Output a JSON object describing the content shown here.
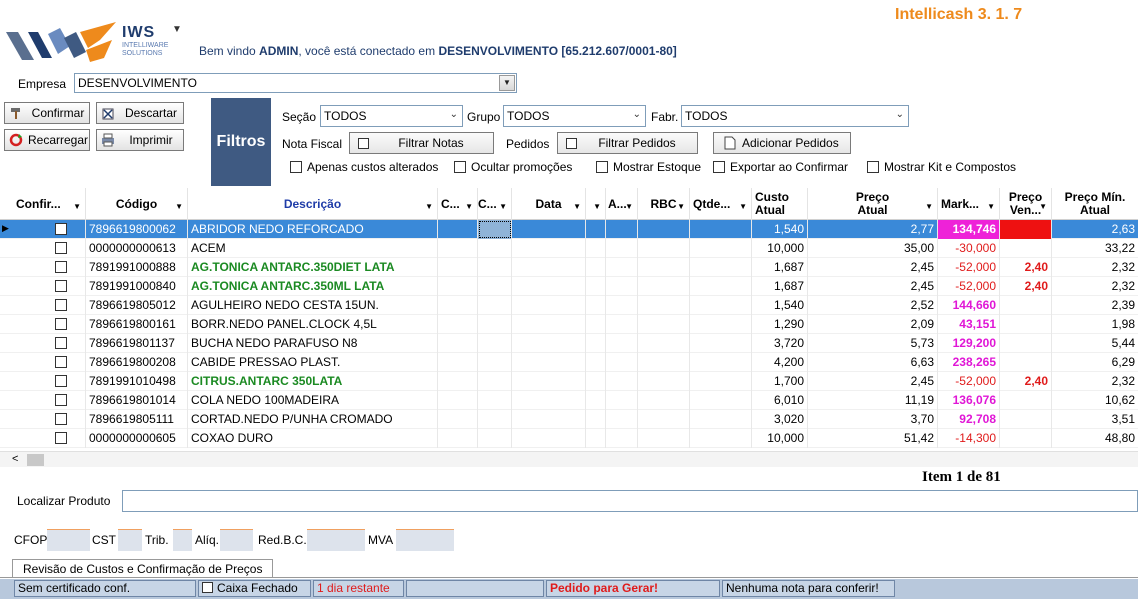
{
  "header": {
    "app_title": "Intellicash 3. 1.  7",
    "logo_name": "IWS",
    "logo_sub1": "INTELLIWARE",
    "logo_sub2": "SOLUTIONS",
    "welcome_pre": "Bem vindo ",
    "user": "ADMIN",
    "welcome_mid": ", você está conectado em ",
    "company": "DESENVOLVIMENTO [65.212.607/0001-80]"
  },
  "empresa": {
    "label": "Empresa",
    "value": "DESENVOLVIMENTO"
  },
  "actions": {
    "confirmar": "Confirmar",
    "descartar": "Descartar",
    "recarregar": "Recarregar",
    "imprimir": "Imprimir"
  },
  "filtros": {
    "title": "Filtros",
    "secao_label": "Seção",
    "secao_value": "TODOS",
    "grupo_label": "Grupo",
    "grupo_value": "TODOS",
    "fabr_label": "Fabr.",
    "fabr_value": "TODOS",
    "nota_label": "Nota Fiscal",
    "filtrar_notas": "Filtrar Notas",
    "pedidos_label": "Pedidos",
    "filtrar_pedidos": "Filtrar Pedidos",
    "adicionar_pedidos": "Adicionar Pedidos",
    "checks": [
      "Apenas custos alterados",
      "Ocultar promoções",
      "Mostrar Estoque",
      "Exportar ao Confirmar",
      "Mostrar Kit e Compostos"
    ]
  },
  "grid": {
    "headers": {
      "confirm": "Confir...",
      "codigo": "Código",
      "descricao": "Descrição",
      "c1": "C...",
      "c2": "C...",
      "data": "Data",
      "a": "A...",
      "rbc": "RBC",
      "qtde": "Qtde...",
      "custo1": "Custo",
      "custo2": "Atual",
      "preco1": "Preço",
      "preco2": "Atual",
      "markup": "Mark...",
      "precoven1": "Preço",
      "precoven2": "Ven...",
      "precomin1": "Preço Mín.",
      "precomin2": "Atual"
    },
    "rows": [
      {
        "codigo": "7896619800062",
        "descricao": "ABRIDOR NEDO REFORCADO",
        "custo": "1,540",
        "preco": "2,77",
        "markup": "134,746",
        "preco_ven": "",
        "preco_min": "2,63",
        "style": "normal",
        "mk": "hl"
      },
      {
        "codigo": "0000000000613",
        "descricao": "ACEM",
        "custo": "10,000",
        "preco": "35,00",
        "markup": "-30,000",
        "preco_ven": "",
        "preco_min": "33,22",
        "style": "normal",
        "mk": "red"
      },
      {
        "codigo": "7891991000888",
        "descricao": "AG.TONICA ANTARC.350DIET LATA",
        "custo": "1,687",
        "preco": "2,45",
        "markup": "-52,000",
        "preco_ven": "2,40",
        "preco_min": "2,32",
        "style": "green",
        "mk": "red"
      },
      {
        "codigo": "7891991000840",
        "descricao": "AG.TONICA ANTARC.350ML LATA",
        "custo": "1,687",
        "preco": "2,45",
        "markup": "-52,000",
        "preco_ven": "2,40",
        "preco_min": "2,32",
        "style": "green",
        "mk": "red"
      },
      {
        "codigo": "7896619805012",
        "descricao": "AGULHEIRO NEDO CESTA 15UN.",
        "custo": "1,540",
        "preco": "2,52",
        "markup": "144,660",
        "preco_ven": "",
        "preco_min": "2,39",
        "style": "normal",
        "mk": "magenta"
      },
      {
        "codigo": "7896619800161",
        "descricao": "BORR.NEDO PANEL.CLOCK 4,5L",
        "custo": "1,290",
        "preco": "2,09",
        "markup": "43,151",
        "preco_ven": "",
        "preco_min": "1,98",
        "style": "normal",
        "mk": "magenta"
      },
      {
        "codigo": "7896619801137",
        "descricao": "BUCHA NEDO PARAFUSO N8",
        "custo": "3,720",
        "preco": "5,73",
        "markup": "129,200",
        "preco_ven": "",
        "preco_min": "5,44",
        "style": "normal",
        "mk": "magenta"
      },
      {
        "codigo": "7896619800208",
        "descricao": "CABIDE PRESSAO PLAST.",
        "custo": "4,200",
        "preco": "6,63",
        "markup": "238,265",
        "preco_ven": "",
        "preco_min": "6,29",
        "style": "normal",
        "mk": "magenta"
      },
      {
        "codigo": "7891991010498",
        "descricao": "CITRUS.ANTARC 350LATA",
        "custo": "1,700",
        "preco": "2,45",
        "markup": "-52,000",
        "preco_ven": "2,40",
        "preco_min": "2,32",
        "style": "green",
        "mk": "red"
      },
      {
        "codigo": "7896619801014",
        "descricao": "COLA NEDO 100MADEIRA",
        "custo": "6,010",
        "preco": "11,19",
        "markup": "136,076",
        "preco_ven": "",
        "preco_min": "10,62",
        "style": "normal",
        "mk": "magenta"
      },
      {
        "codigo": "7896619805111",
        "descricao": "CORTAD.NEDO P/UNHA CROMADO",
        "custo": "3,020",
        "preco": "3,70",
        "markup": "92,708",
        "preco_ven": "",
        "preco_min": "3,51",
        "style": "normal",
        "mk": "magenta"
      },
      {
        "codigo": "0000000000605",
        "descricao": "COXAO DURO",
        "custo": "10,000",
        "preco": "51,42",
        "markup": "-14,300",
        "preco_ven": "",
        "preco_min": "48,80",
        "style": "normal",
        "mk": "red"
      }
    ]
  },
  "item_count": "Item 1 de 81",
  "localizar": {
    "label": "Localizar Produto",
    "value": ""
  },
  "tax": {
    "cfop": "CFOP",
    "cst": "CST",
    "trib": "Trib.",
    "aliq": "Alíq.",
    "redbc": "Red.B.C.",
    "mva": "MVA"
  },
  "tab": {
    "label": "Revisão de Custos e Confirmação de Preços"
  },
  "status": {
    "cert": "Sem certificado conf.",
    "caixa": "Caixa Fechado",
    "dias": "1 dia restante",
    "empty": "",
    "pedido": "Pedido para Gerar!",
    "nota": "Nenhuma nota para conferir!"
  },
  "colors": {
    "accent": "#ee8a1c",
    "navy": "#1f3c6d",
    "filtros_bg": "#3f5a82",
    "selected": "#3a89d8",
    "green": "#1b8a22",
    "magenta": "#e016d6",
    "red": "#e01b1b"
  }
}
